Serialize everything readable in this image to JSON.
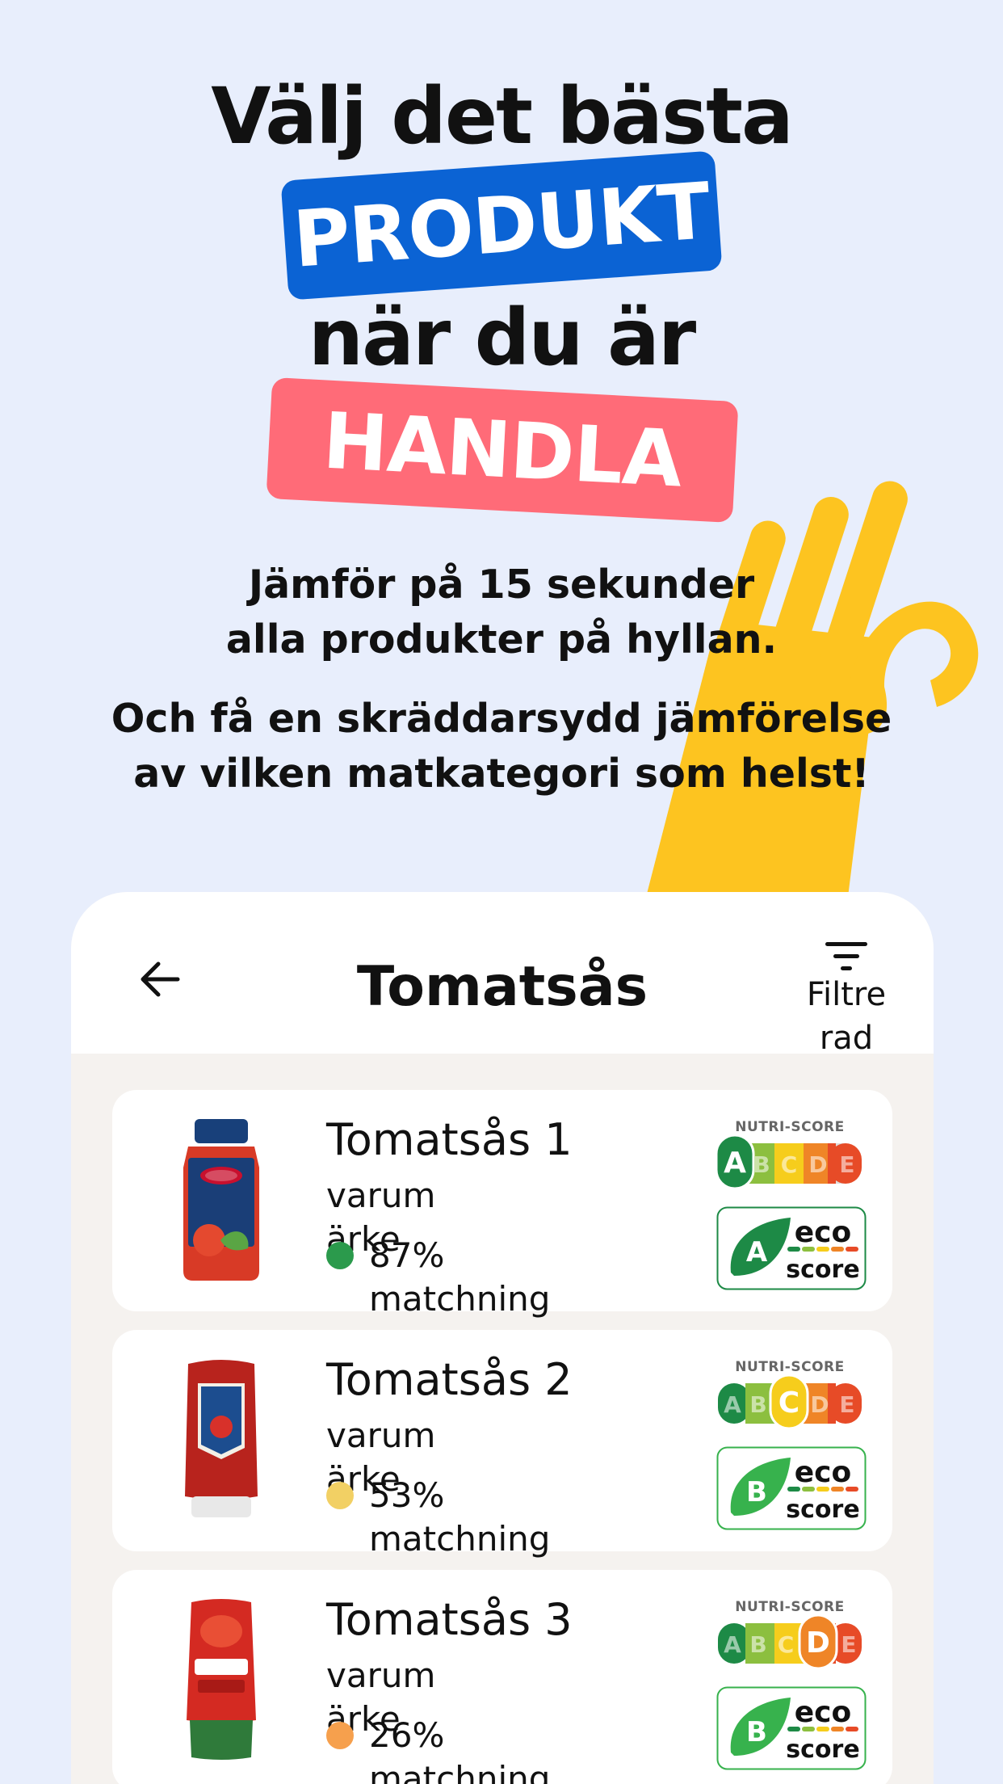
{
  "hero": {
    "line1": "Välj det bästa",
    "tag1": "PRODUKT",
    "line3": "när du är",
    "tag2": "HANDLA",
    "sub1_a": "Jämför på 15 sekunder",
    "sub1_b": "alla produkter på hyllan.",
    "sub2_a": "Och få en skräddarsydd jämförelse",
    "sub2_b": "av vilken matkategori som helst!"
  },
  "colors": {
    "background": "#e8eefc",
    "tag1": "#0b63d4",
    "tag2": "#ff6b78",
    "hand": "#fdc420"
  },
  "app": {
    "title": "Tomatsås",
    "filter_label": "Filtre rad",
    "back_icon": "arrow-left-icon",
    "filter_icon": "filter-icon"
  },
  "products": [
    {
      "name": "Tomatsås 1",
      "brand": "varum ärke",
      "match": "87% matchning",
      "dot_color": "#2b9a4c",
      "nutri_label": "NUTRI-SCORE",
      "nutri_grade": "A",
      "eco_grade": "A",
      "eco_word1": "eco",
      "eco_word2": "score"
    },
    {
      "name": "Tomatsås 2",
      "brand": "varum ärke",
      "match": "53% matchning",
      "dot_color": "#f2d064",
      "nutri_label": "NUTRI-SCORE",
      "nutri_grade": "C",
      "eco_grade": "B",
      "eco_word1": "eco",
      "eco_word2": "score"
    },
    {
      "name": "Tomatsås 3",
      "brand": "varum ärke",
      "match": "26% matchning",
      "dot_color": "#f6a04d",
      "nutri_label": "NUTRI-SCORE",
      "nutri_grade": "D",
      "eco_grade": "B",
      "eco_word1": "eco",
      "eco_word2": "score"
    }
  ]
}
